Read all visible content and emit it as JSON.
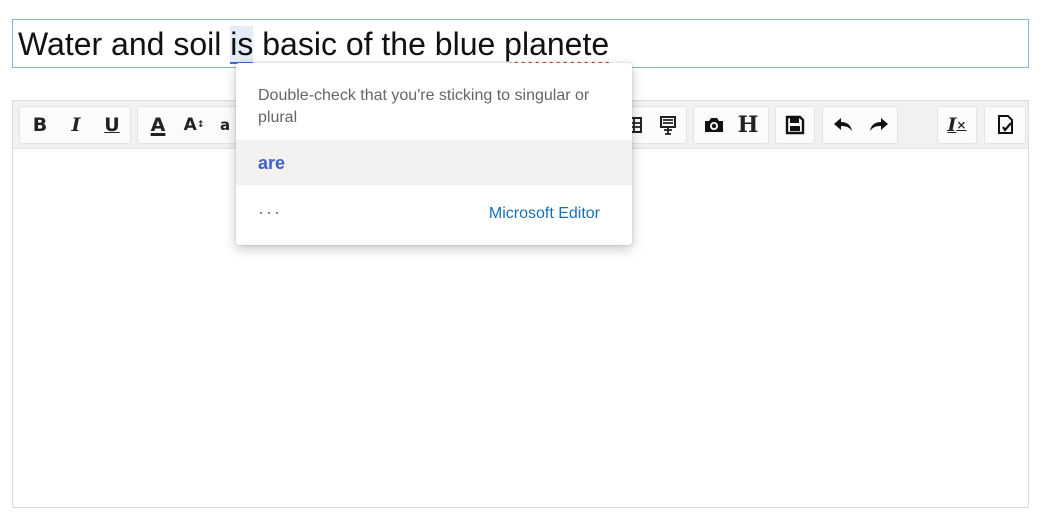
{
  "title_field": {
    "words": {
      "before": "Water and soil ",
      "flagged": "is",
      "middle": " basic of the blue ",
      "misspelled": "planete"
    }
  },
  "toolbar": {
    "bold_label": "B",
    "italic_label": "I",
    "underline_label": "U",
    "font_color_label": "A",
    "font_size_label": "A",
    "font_size_suffix": "↕",
    "lettercase_label": "a",
    "heading_label": "H",
    "clear_format_label": "I",
    "clear_format_suffix": "×"
  },
  "popup": {
    "message": "Double-check that you're sticking to singular or plural",
    "suggestion": "are",
    "more_label": "···",
    "brand": "Microsoft Editor"
  },
  "colors": {
    "accent_blue": "#3f5fcf",
    "brand_blue": "#1a6fb8",
    "misspell_red": "#dd2222",
    "field_border": "#7fb7e0"
  }
}
